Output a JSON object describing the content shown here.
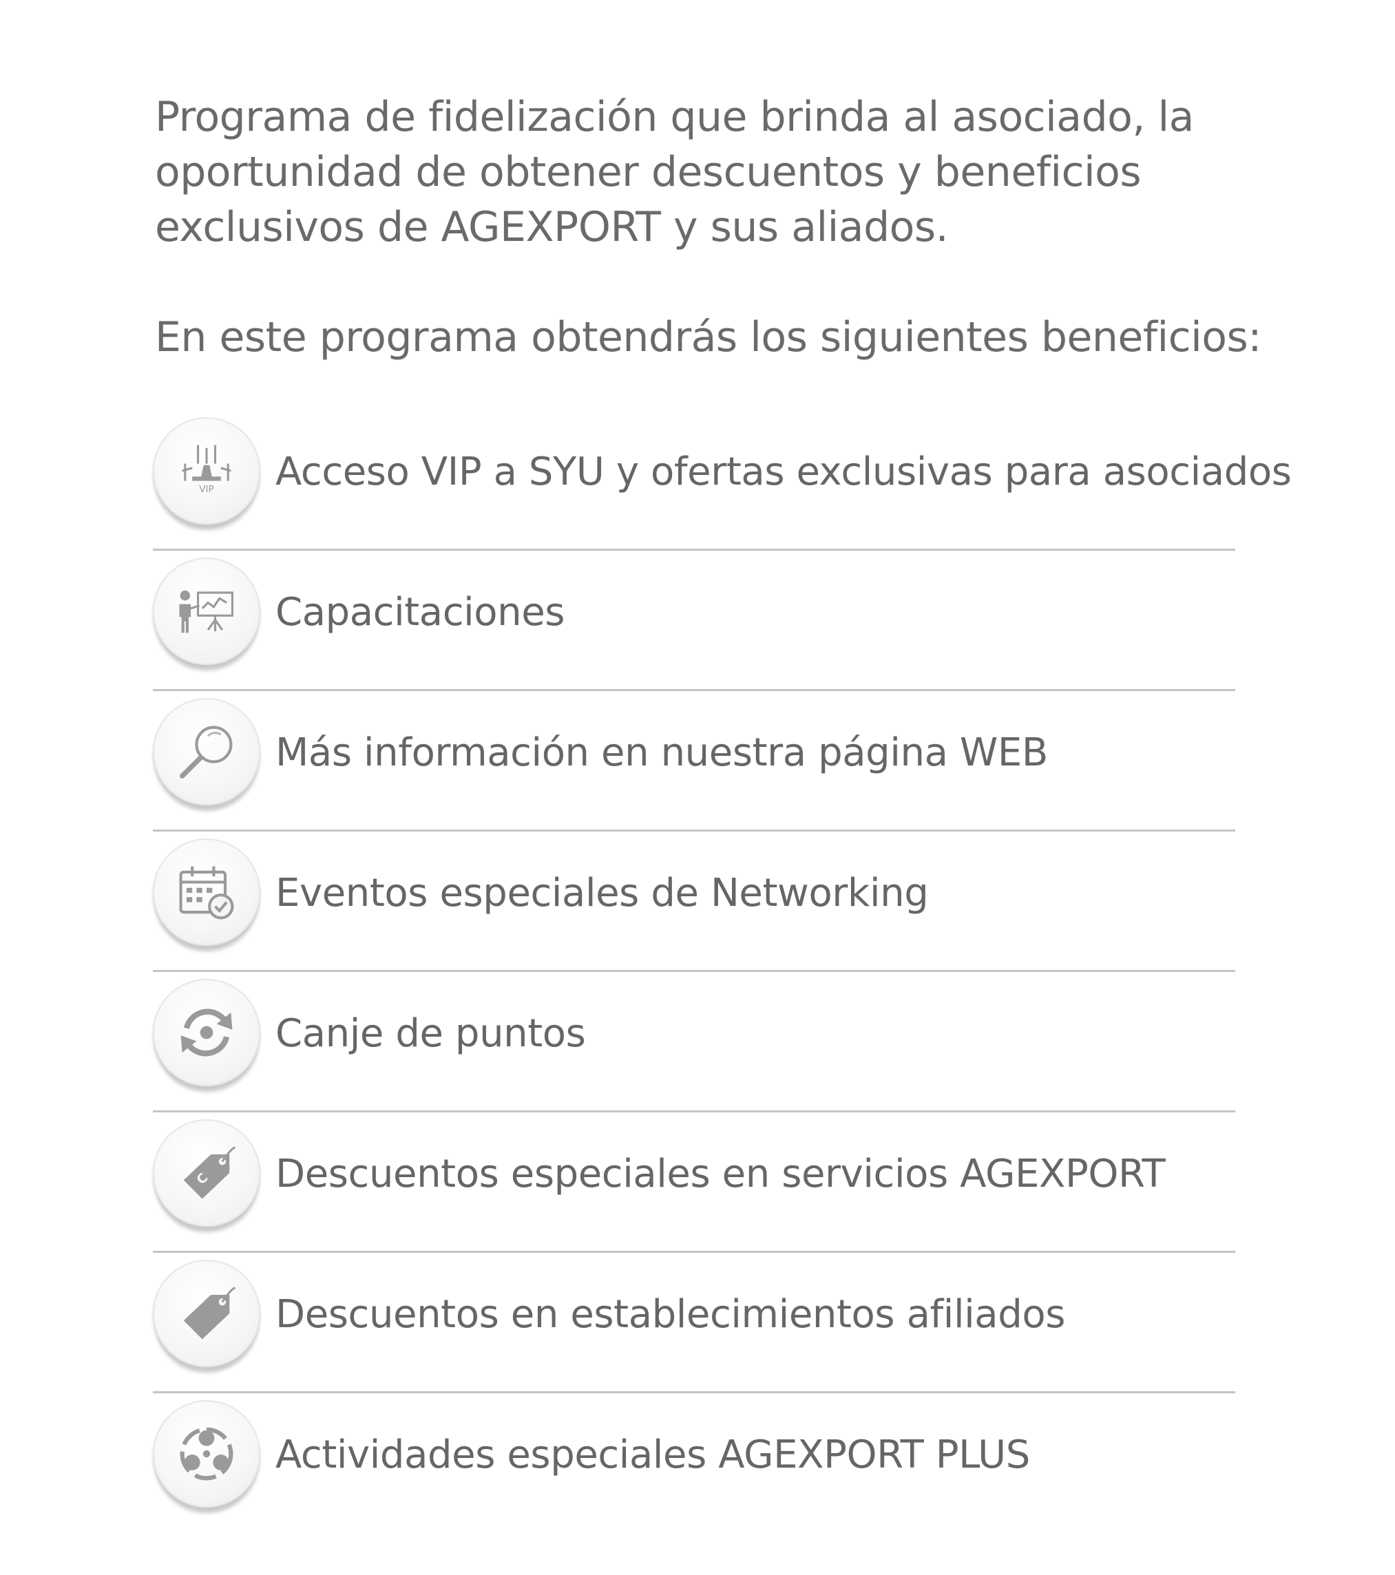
{
  "intro": {
    "text": "Programa de fidelización que brinda al asociado, la oportunidad de obtener descuentos y beneficios exclusivos de AGEXPORT y sus aliados."
  },
  "lead": {
    "text": "En este programa obtendrás los siguientes beneficios:"
  },
  "benefits": [
    {
      "label": "Acceso VIP a SYU y ofertas exclusivas para asociados",
      "icon": "vip-stage-icon",
      "icon_text": "VIP"
    },
    {
      "label": "Capacitaciones",
      "icon": "presentation-icon"
    },
    {
      "label": "Más información en nuestra página WEB",
      "icon": "magnifier-icon"
    },
    {
      "label": "Eventos especiales de Networking",
      "icon": "calendar-check-icon"
    },
    {
      "label": "Canje de puntos",
      "icon": "exchange-icon"
    },
    {
      "label": "Descuentos especiales en servicios AGEXPORT",
      "icon": "price-tag-icon"
    },
    {
      "label": "Descuentos en establecimientos afiliados",
      "icon": "tag-icon"
    },
    {
      "label": "Actividades especiales AGEXPORT PLUS",
      "icon": "community-icon"
    }
  ],
  "colors": {
    "text": "#666666",
    "icon": "#9a9a9a",
    "divider": "#c4c4c4"
  }
}
